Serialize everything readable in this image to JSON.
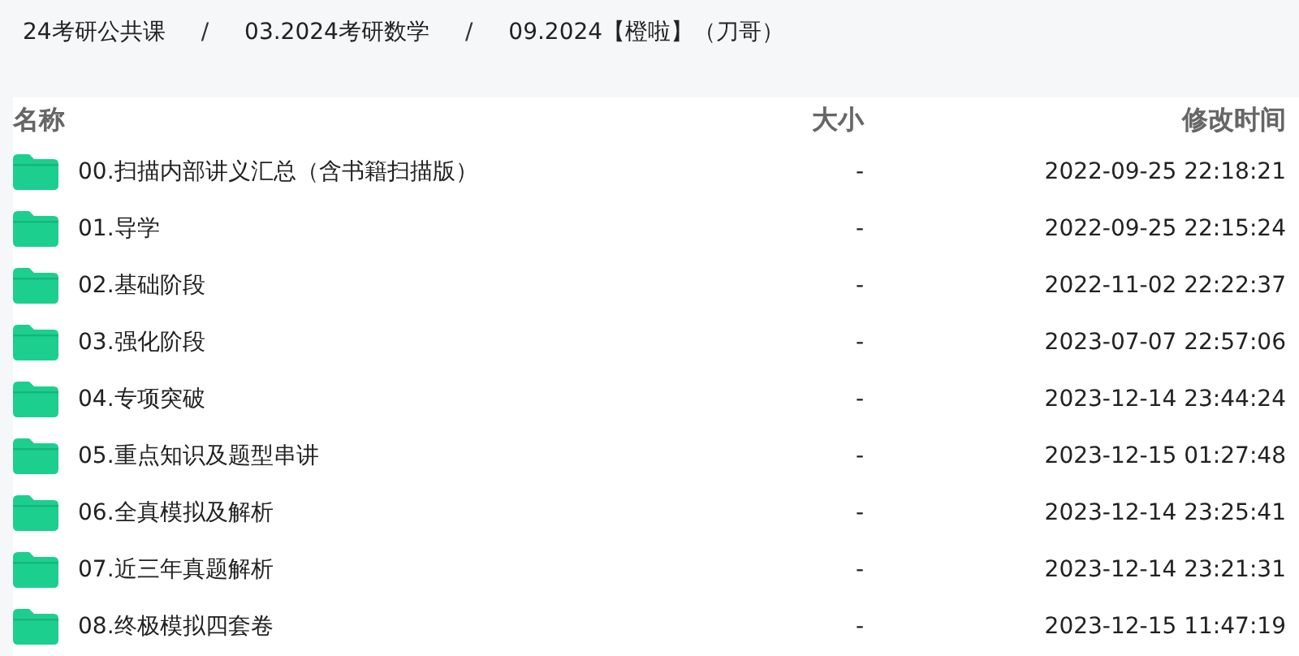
{
  "breadcrumb": {
    "separator": "/",
    "items": [
      "24考研公共课",
      "03.2024考研数学",
      "09.2024【橙啦】（刀哥）"
    ]
  },
  "table": {
    "columns": [
      "名称",
      "大小",
      "修改时间"
    ],
    "rows": [
      {
        "name": "00.扫描内部讲义汇总（含书籍扫描版）",
        "size": "-",
        "modified": "2022-09-25 22:18:21"
      },
      {
        "name": "01.导学",
        "size": "-",
        "modified": "2022-09-25 22:15:24"
      },
      {
        "name": "02.基础阶段",
        "size": "-",
        "modified": "2022-11-02 22:22:37"
      },
      {
        "name": "03.强化阶段",
        "size": "-",
        "modified": "2023-07-07 22:57:06"
      },
      {
        "name": "04.专项突破",
        "size": "-",
        "modified": "2023-12-14 23:44:24"
      },
      {
        "name": "05.重点知识及题型串讲",
        "size": "-",
        "modified": "2023-12-15 01:27:48"
      },
      {
        "name": "06.全真模拟及解析",
        "size": "-",
        "modified": "2023-12-14 23:25:41"
      },
      {
        "name": "07.近三年真题解析",
        "size": "-",
        "modified": "2023-12-14 23:21:31"
      },
      {
        "name": "08.终极模拟四套卷",
        "size": "-",
        "modified": "2023-12-15 11:47:19"
      }
    ]
  }
}
